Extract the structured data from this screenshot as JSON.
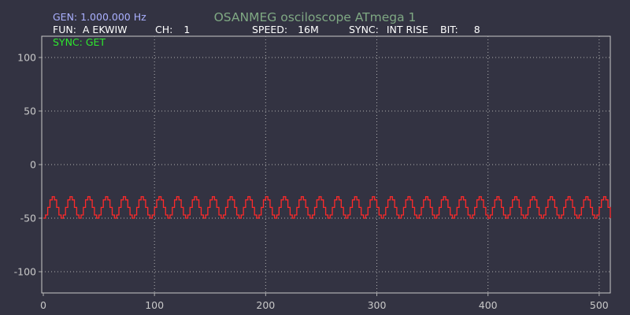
{
  "header": {
    "title": "OSANMEG osciloscope ATmega 1",
    "gen_label": "GEN: 1.000.000 Hz",
    "sync_status": "SYNC: GET"
  },
  "params": {
    "fun": {
      "label": "FUN:",
      "value": "A EKWIW"
    },
    "ch": {
      "label": "CH:",
      "value": "1"
    },
    "speed": {
      "label": "SPEED:",
      "value": "16M"
    },
    "sync": {
      "label": "SYNC:",
      "value": "INT RISE"
    },
    "bit": {
      "label": "BIT:",
      "value": "8"
    }
  },
  "colors": {
    "background": "#333342",
    "trace": "#ff2a2a",
    "title": "#7fa883",
    "gen": "#aab0ff",
    "sync_status": "#2ee82e",
    "grid": "#b0b0b0"
  },
  "chart_data": {
    "type": "line",
    "title": "",
    "xlabel": "",
    "ylabel": "",
    "xlim": [
      0,
      512
    ],
    "ylim": [
      -120,
      120
    ],
    "x_ticks": [
      0,
      100,
      200,
      300,
      400,
      500
    ],
    "y_ticks": [
      100,
      50,
      0,
      -50,
      -100
    ],
    "grid": true,
    "grid_style": "dotted",
    "series": [
      {
        "waveform": "stepped sine",
        "period_samples": 16,
        "step_samples": 2,
        "cycles": 32,
        "max": -30,
        "min": -50,
        "start": -48
      }
    ]
  }
}
